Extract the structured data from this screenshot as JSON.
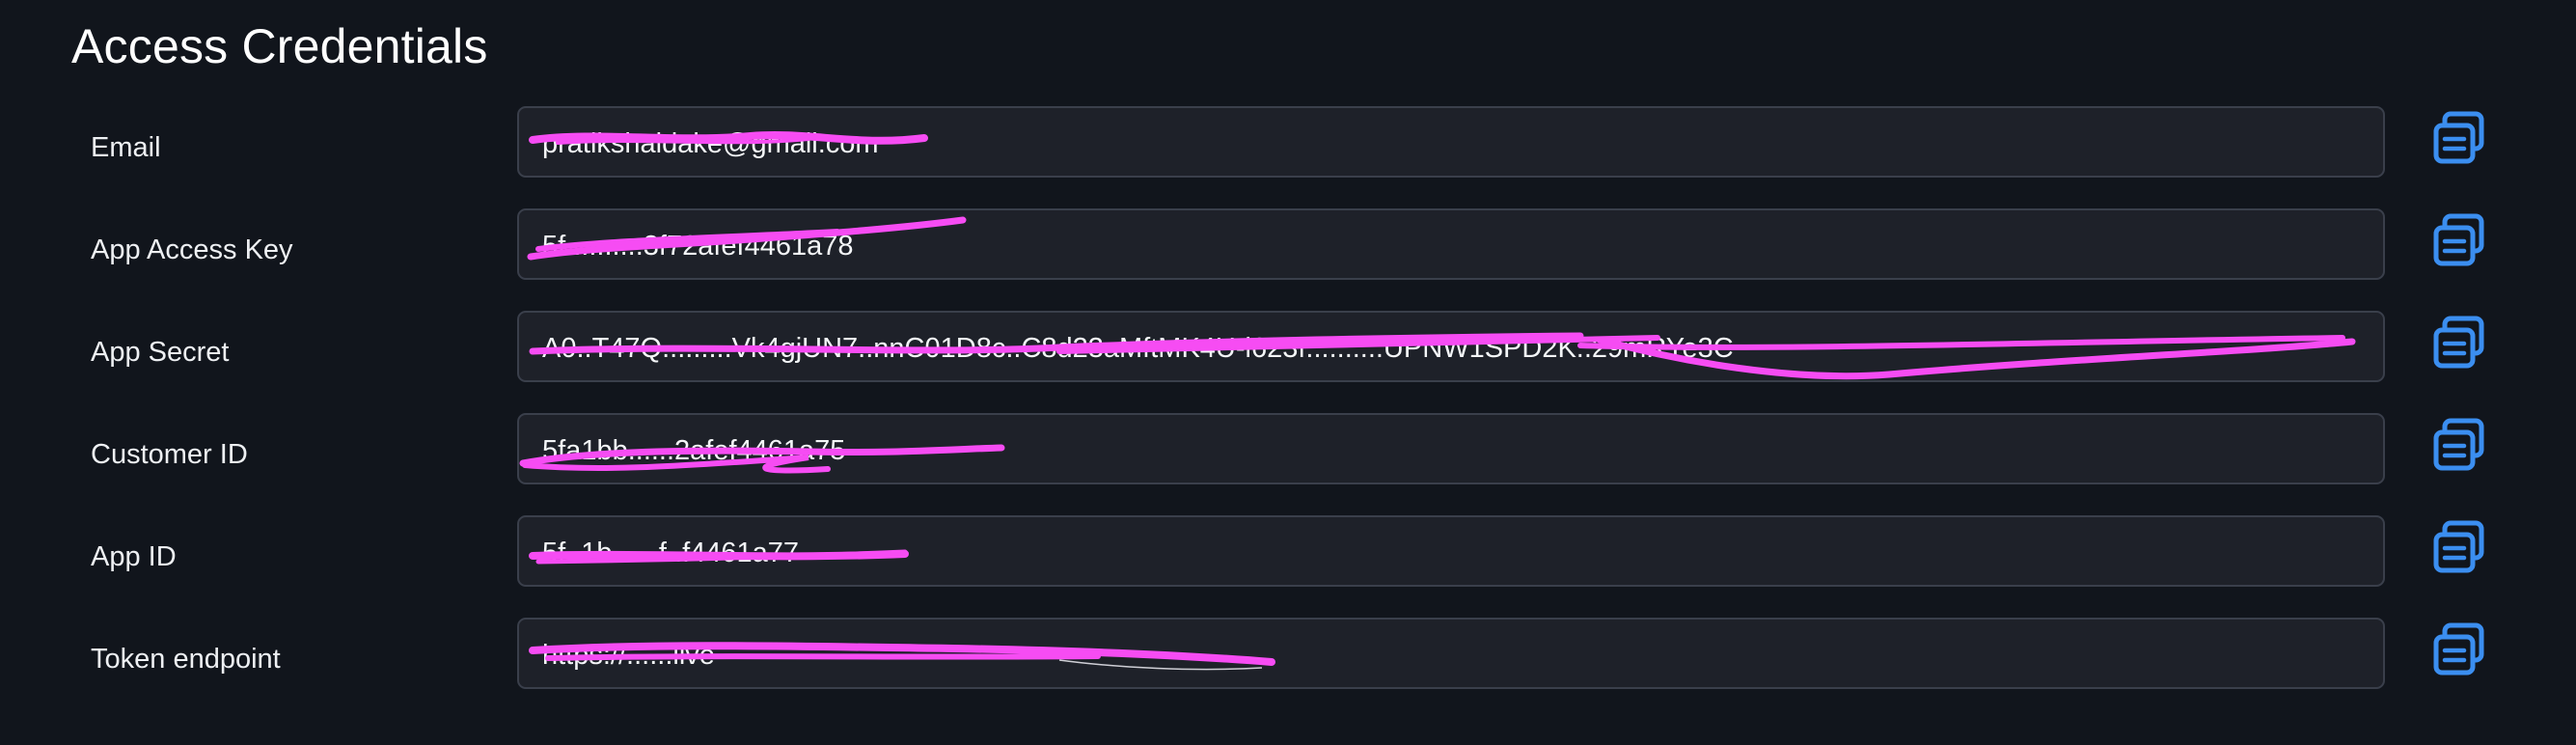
{
  "title": "Access Credentials",
  "accent_color": "#3b8ef0",
  "redaction_color": "#f64cf3",
  "copy_icon": "copy-icon",
  "rows": [
    {
      "label": "Email",
      "value": "pratikshaldake@gmail.com"
    },
    {
      "label": "App Access Key",
      "value": "5f..........3f72afef4461a78"
    },
    {
      "label": "App Secret",
      "value": "A0..T47Q.........Vk4gjUN7..nnC01D8c..C8d23aMftMK4U-i623f..........UPNW1SPD2K..29mRYe3C"
    },
    {
      "label": "Customer ID",
      "value": "5fa1bb......2afef4461a75"
    },
    {
      "label": "App ID",
      "value": "5f..1b......f..f4461a77"
    },
    {
      "label": "Token endpoint",
      "value": "https://......live"
    }
  ]
}
